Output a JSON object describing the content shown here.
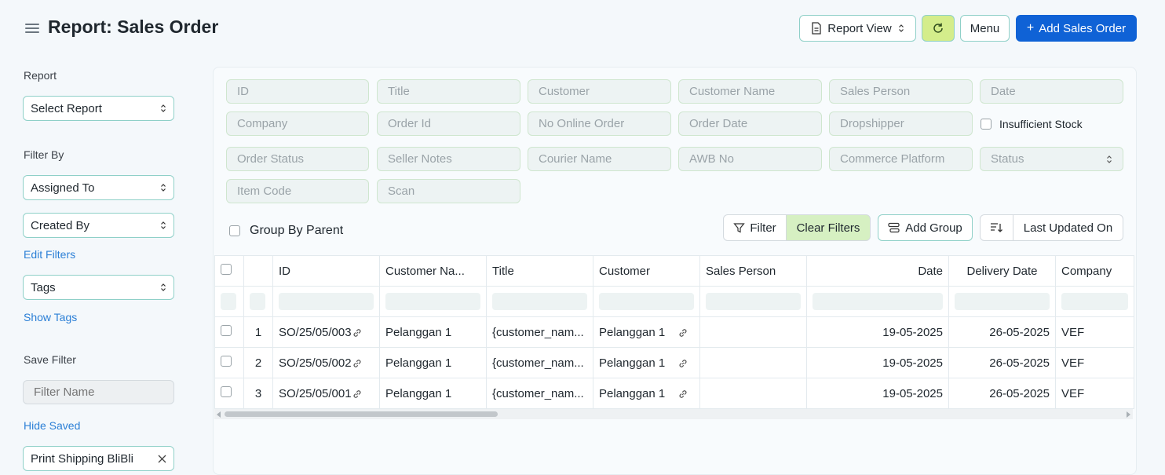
{
  "header": {
    "title": "Report: Sales Order",
    "report_view_label": "Report View",
    "menu_label": "Menu",
    "add_label": "Add Sales Order"
  },
  "sidebar": {
    "report_label": "Report",
    "select_report": "Select Report",
    "filter_by_label": "Filter By",
    "assigned_to": "Assigned To",
    "created_by": "Created By",
    "edit_filters": "Edit Filters",
    "tags": "Tags",
    "show_tags": "Show Tags",
    "save_filter_label": "Save Filter",
    "filter_name_placeholder": "Filter Name",
    "hide_saved": "Hide Saved",
    "saved_filter": "Print Shipping BliBli"
  },
  "filters": {
    "id": "ID",
    "title": "Title",
    "customer": "Customer",
    "customer_name": "Customer Name",
    "sales_person": "Sales Person",
    "date": "Date",
    "company": "Company",
    "order_id": "Order Id",
    "no_online_order": "No Online Order",
    "order_date": "Order Date",
    "dropshipper": "Dropshipper",
    "insufficient_stock": "Insufficient Stock",
    "order_status": "Order Status",
    "seller_notes": "Seller Notes",
    "courier_name": "Courier Name",
    "awb_no": "AWB No",
    "commerce_platform": "Commerce Platform",
    "status": "Status",
    "item_code": "Item Code",
    "scan": "Scan"
  },
  "toolbar": {
    "group_by_parent": "Group By Parent",
    "filter": "Filter",
    "clear_filters": "Clear Filters",
    "add_group": "Add Group",
    "sort_label": "Last Updated On"
  },
  "table": {
    "columns": [
      "ID",
      "Customer Na...",
      "Title",
      "Customer",
      "Sales Person",
      "Date",
      "Delivery Date",
      "Company"
    ],
    "rows": [
      {
        "num": "1",
        "id": "SO/25/05/003",
        "customer_name": "Pelanggan 1",
        "title": "{customer_nam...",
        "customer": "Pelanggan 1",
        "sales_person": "",
        "date": "19-05-2025",
        "delivery_date": "26-05-2025",
        "company": "VEF"
      },
      {
        "num": "2",
        "id": "SO/25/05/002",
        "customer_name": "Pelanggan 1",
        "title": "{customer_nam...",
        "customer": "Pelanggan 1",
        "sales_person": "",
        "date": "19-05-2025",
        "delivery_date": "26-05-2025",
        "company": "VEF"
      },
      {
        "num": "3",
        "id": "SO/25/05/001",
        "customer_name": "Pelanggan 1",
        "title": "{customer_nam...",
        "customer": "Pelanggan 1",
        "sales_person": "",
        "date": "19-05-2025",
        "delivery_date": "26-05-2025",
        "company": "VEF"
      }
    ]
  },
  "colors": {
    "accent": "#0f62d6",
    "refresh": "#d4ed8b",
    "clear": "#d6f0c2",
    "border": "#8fd0c8"
  }
}
